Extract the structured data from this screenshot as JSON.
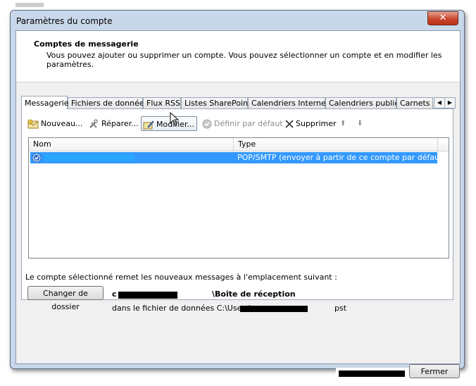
{
  "window": {
    "title": "Paramètres du compte",
    "close_glyph": "✕"
  },
  "header": {
    "title": "Comptes de messagerie",
    "description": "Vous pouvez ajouter ou supprimer un compte. Vous pouvez sélectionner un compte et en modifier les paramètres."
  },
  "tabs": [
    {
      "label": "Messagerie",
      "active": true
    },
    {
      "label": "Fichiers de données",
      "active": false
    },
    {
      "label": "Flux RSS",
      "active": false
    },
    {
      "label": "Listes SharePoint",
      "active": false
    },
    {
      "label": "Calendriers Internet",
      "active": false
    },
    {
      "label": "Calendriers publiés",
      "active": false
    },
    {
      "label": "Carnets d",
      "active": false
    }
  ],
  "tab_scroll": {
    "left": "◀",
    "right": "▶"
  },
  "toolbar": {
    "new_label": "Nouveau...",
    "repair_label": "Réparer...",
    "modify_label": "Modifier...",
    "set_default_label": "Définir par défaut",
    "delete_label": "Supprimer",
    "up_glyph": "⬆",
    "down_glyph": "⬇"
  },
  "list": {
    "columns": [
      "Nom",
      "Type"
    ],
    "rows": [
      {
        "name": "",
        "type": "POP/SMTP (envoyer à partir de ce compte par défaut)",
        "selected": true
      }
    ]
  },
  "delivery": {
    "label": "Le compte sélectionné remet les nouveaux messages à l'emplacement suivant :",
    "change_folder_label": "Changer de dossier",
    "folder_prefix": "c",
    "folder_name": "\\Boîte de réception",
    "path_prefix": "dans le fichier de données C:\\Users\\...",
    "path_ext": "pst"
  },
  "footer": {
    "close_label": "Fermer"
  },
  "colors": {
    "selection": "#3399ff",
    "window_frame": "#c8d7e9",
    "close_button": "#c9472b"
  }
}
